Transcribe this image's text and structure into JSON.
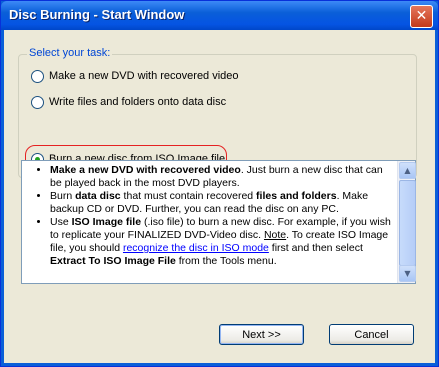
{
  "window": {
    "title": "Disc Burning - Start Window",
    "close_glyph": "✕"
  },
  "task_group": {
    "legend": "Select your task:",
    "options": [
      {
        "label": "Make a new DVD with recovered video",
        "selected": false
      },
      {
        "label": "Write files and folders onto data disc",
        "selected": false
      },
      {
        "label": "Burn a new disc from ISO Image file",
        "selected": true
      }
    ]
  },
  "info": {
    "items": [
      {
        "parts": [
          {
            "t": "Make a new DVD with recovered video",
            "b": true
          },
          {
            "t": ". Just burn a new disc that can be played back in the most DVD players."
          }
        ]
      },
      {
        "parts": [
          {
            "t": "Burn "
          },
          {
            "t": "data disc",
            "b": true
          },
          {
            "t": " that must contain recovered "
          },
          {
            "t": "files and folders",
            "b": true
          },
          {
            "t": ". Make backup CD or DVD. Further, you can read the disc on any PC."
          }
        ]
      },
      {
        "parts": [
          {
            "t": "Use "
          },
          {
            "t": "ISO Image file",
            "b": true
          },
          {
            "t": " (.iso file) to burn a new disc. For example, if you wish to replicate your FINALIZED DVD-Video disc. "
          },
          {
            "t": "Note",
            "u": true
          },
          {
            "t": ". To create ISO Image file, you should "
          },
          {
            "t": "recognize the disc in ISO mode",
            "link": true
          },
          {
            "t": " first and then select "
          },
          {
            "t": "Extract To ISO Image File",
            "b": true
          },
          {
            "t": " from the Tools menu."
          }
        ]
      }
    ],
    "scroll_up": "▲",
    "scroll_down": "▼"
  },
  "buttons": {
    "next": "Next >>",
    "cancel": "Cancel"
  }
}
